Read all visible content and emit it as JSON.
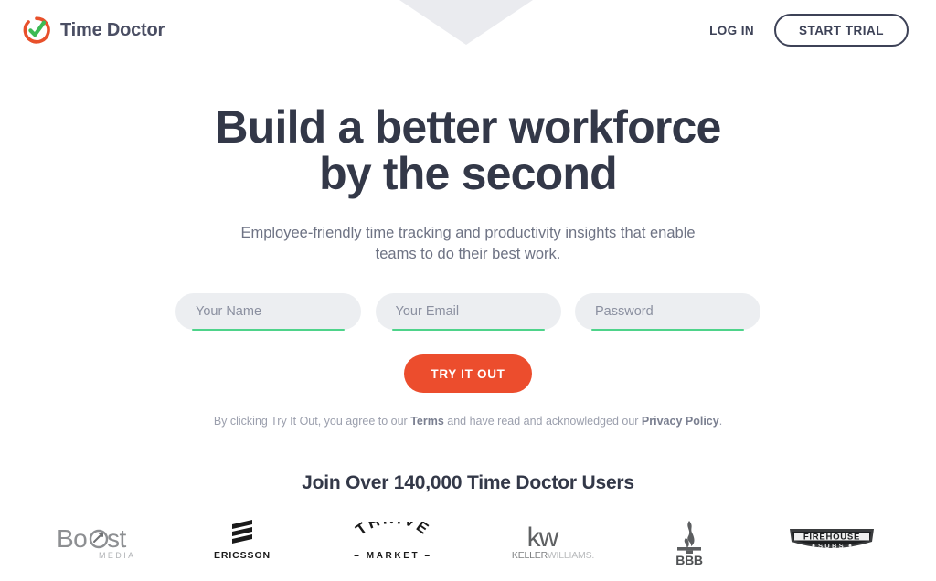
{
  "brand": {
    "name": "Time Doctor",
    "logo_icon": "time-doctor-circle-check-icon",
    "accent_orange": "#e8502b",
    "accent_green": "#3cba54"
  },
  "header": {
    "login_label": "LOG IN",
    "start_trial_label": "START TRIAL"
  },
  "hero": {
    "title_line1": "Build a better workforce",
    "title_line2": "by the second",
    "subtitle_line1": "Employee-friendly time tracking and productivity insights that enable",
    "subtitle_line2": "teams to do their best work."
  },
  "signup": {
    "fields": [
      {
        "name": "name",
        "placeholder": "Your Name",
        "value": ""
      },
      {
        "name": "email",
        "placeholder": "Your Email",
        "value": ""
      },
      {
        "name": "password",
        "placeholder": "Password",
        "value": ""
      }
    ],
    "cta_label": "TRY IT OUT",
    "cta_color": "#ec4d2d",
    "underline_color": "#4ed38a",
    "legal_prefix": "By clicking Try It Out, you agree to our ",
    "legal_terms": "Terms",
    "legal_middle": " and have read and acknowledged our ",
    "legal_privacy": "Privacy Policy",
    "legal_suffix": "."
  },
  "social_proof": {
    "heading": "Join Over 140,000 Time Doctor Users",
    "logos": [
      {
        "name": "boost-media-logo",
        "label": "Boost MEDIA"
      },
      {
        "name": "ericsson-logo",
        "label": "ERICSSON"
      },
      {
        "name": "thrive-market-logo",
        "label": "THRIVE MARKET"
      },
      {
        "name": "keller-williams-logo",
        "label": "kw KELLERWILLIAMS."
      },
      {
        "name": "bbb-logo",
        "label": "BBB"
      },
      {
        "name": "firehouse-subs-logo",
        "label": "FIREHOUSE SUBS"
      }
    ]
  }
}
